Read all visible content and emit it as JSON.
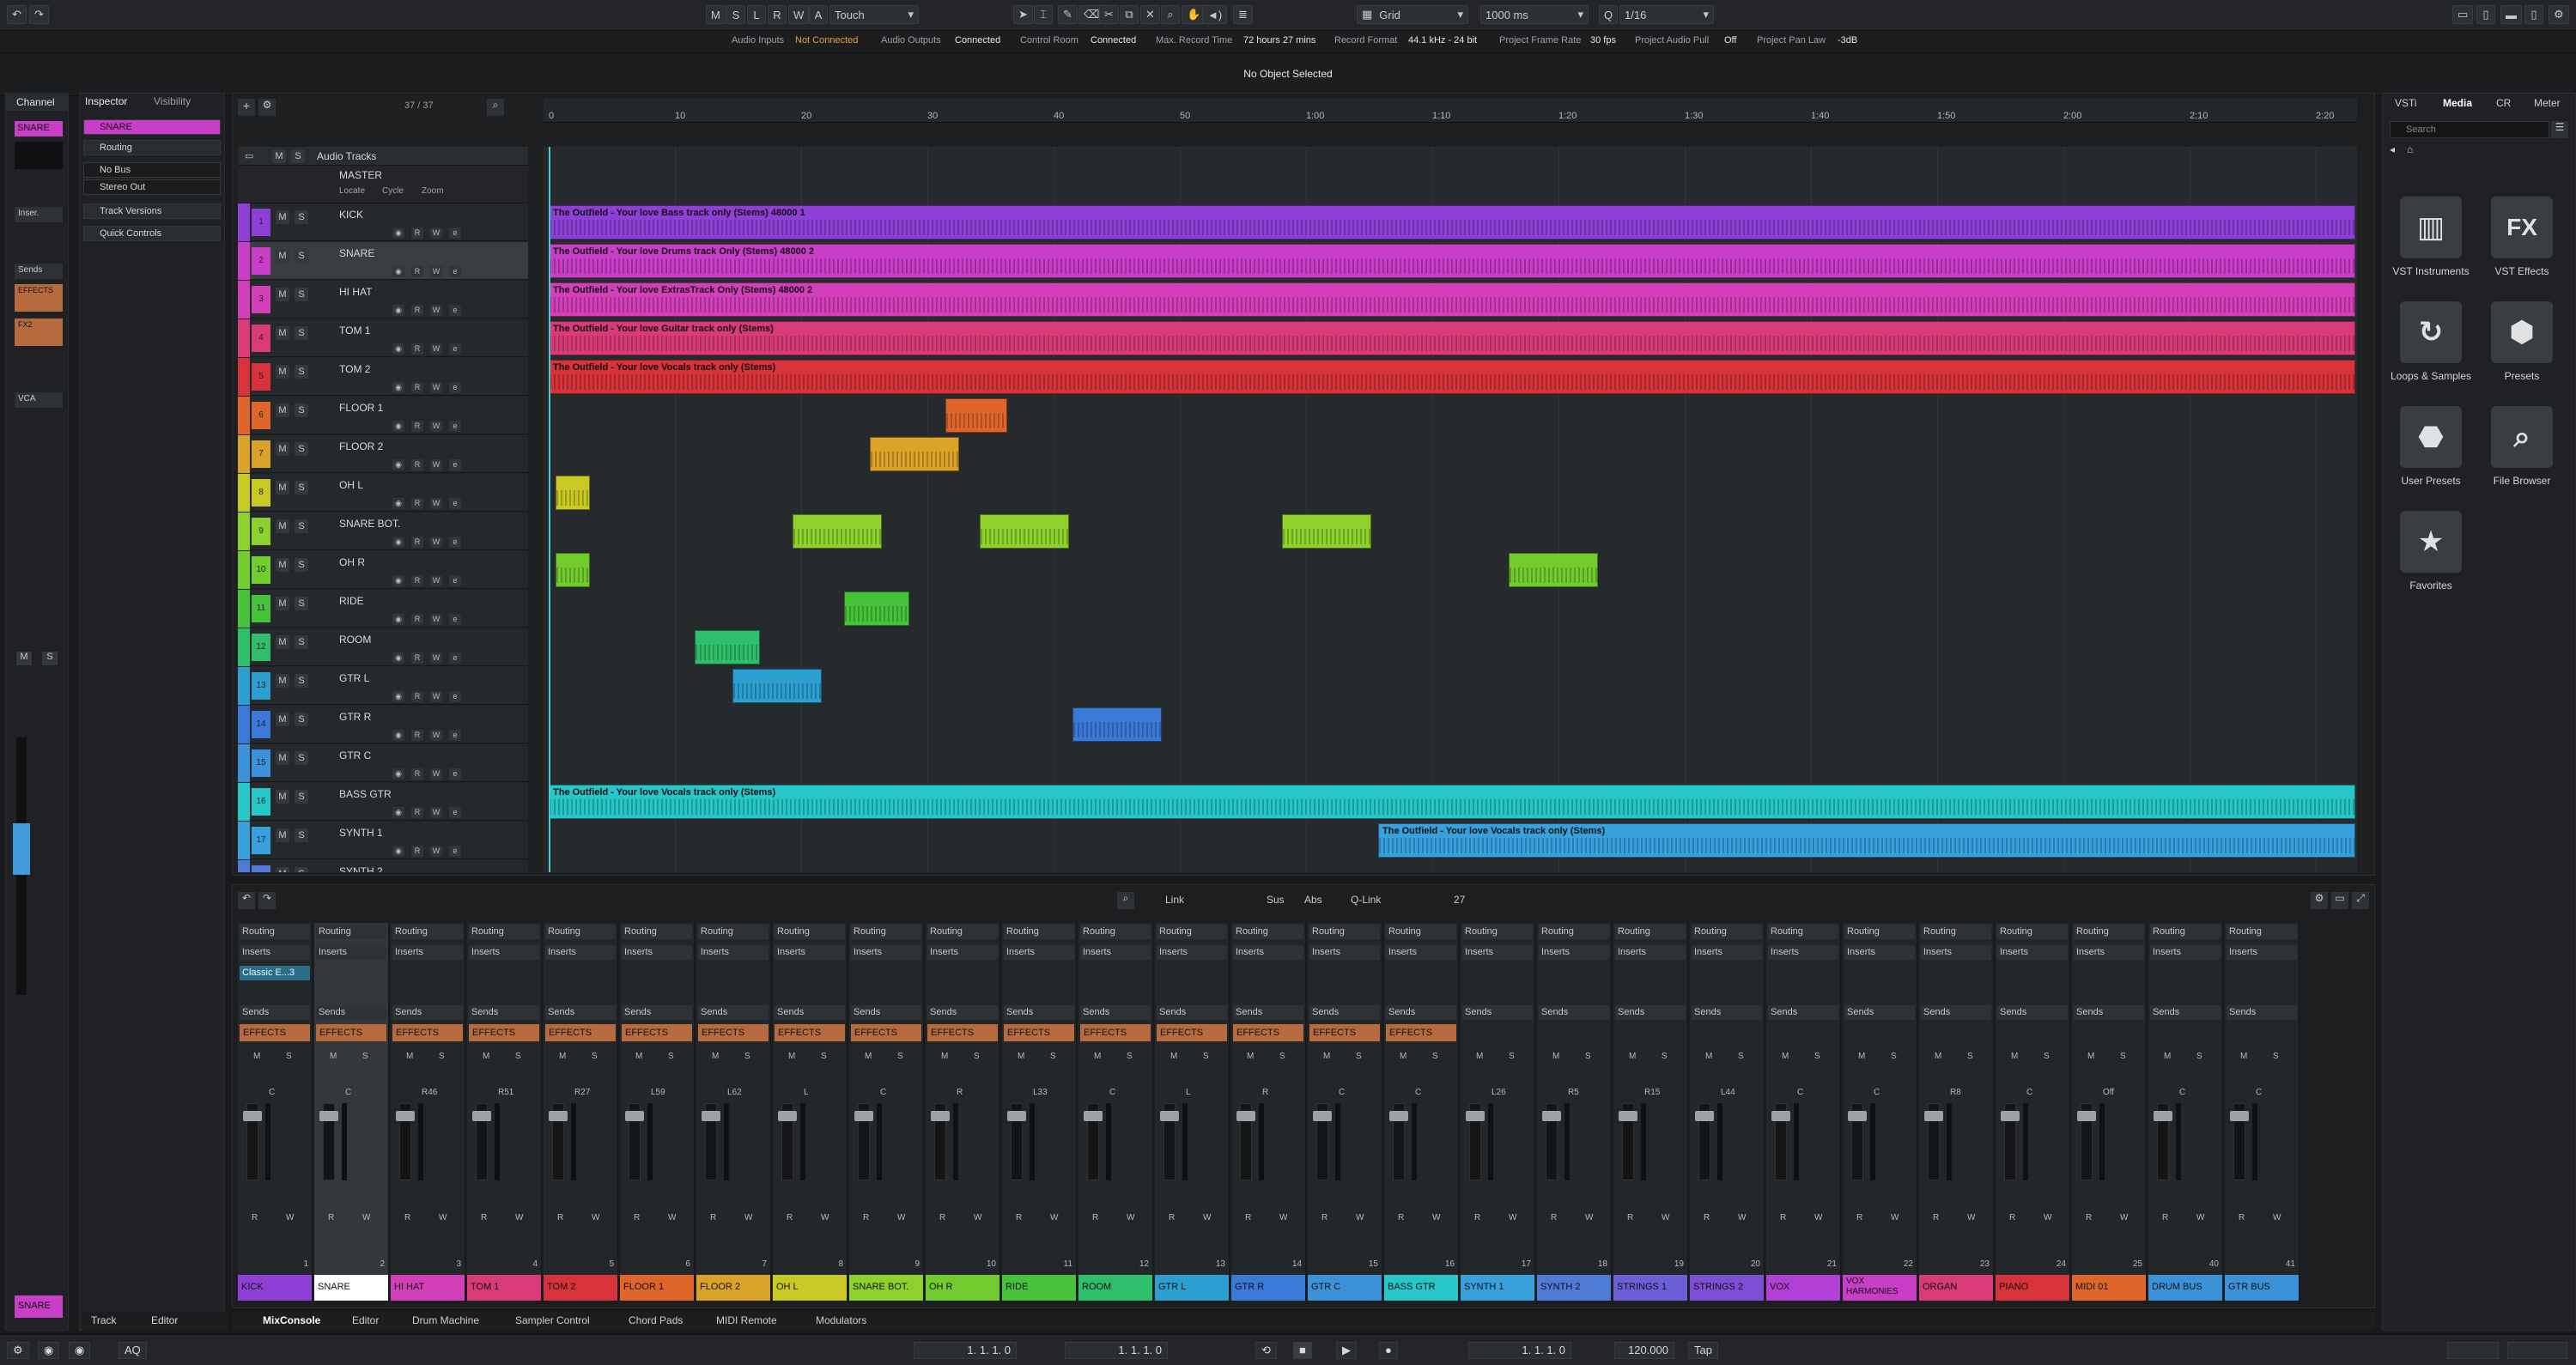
{
  "toolbar": {
    "msl": [
      "M",
      "S",
      "L",
      "R",
      "W",
      "A"
    ],
    "automation_mode": "Touch",
    "snap_type": "Grid",
    "grid_interval": "1000 ms",
    "quantize": "1/16"
  },
  "status": {
    "audio_inputs_label": "Audio Inputs",
    "audio_inputs_value": "Not Connected",
    "audio_outputs_label": "Audio Outputs",
    "audio_outputs_value": "Connected",
    "control_room_label": "Control Room",
    "control_room_value": "Connected",
    "max_record_label": "Max. Record Time",
    "max_record_value": "72 hours 27 mins",
    "record_format_label": "Record Format",
    "record_format_value": "44.1 kHz - 24 bit",
    "frame_rate_label": "Project Frame Rate",
    "frame_rate_value": "30 fps",
    "audio_pull_label": "Project Audio Pull",
    "audio_pull_value": "Off",
    "pan_law_label": "Project Pan Law",
    "pan_law_value": "-3dB"
  },
  "info_line": "No Object Selected",
  "channel_pane": {
    "tab": "Channel",
    "track_name": "SNARE",
    "insert_label": "Inser.",
    "sends_label": "Sends",
    "effects_label": "EFFECTS",
    "fx2_label": "FX2",
    "vca_label": "VCA",
    "footer_name": "SNARE"
  },
  "inspector": {
    "tab_inspector": "Inspector",
    "tab_visibility": "Visibility",
    "track_name": "SNARE",
    "routing": "Routing",
    "input_bus": "No Bus",
    "output_bus": "Stereo Out",
    "track_versions": "Track Versions",
    "quick_controls": "Quick Controls"
  },
  "project": {
    "track_counter": "37 / 37",
    "folder_name": "Audio Tracks",
    "master_name": "MASTER",
    "locate_label": "Locate",
    "cycle_label": "Cycle",
    "zoom_label": "Zoom",
    "ruler_ticks": [
      "0",
      "10",
      "20",
      "30",
      "40",
      "50",
      "1:00",
      "1:10",
      "1:20",
      "1:30",
      "1:40",
      "1:50",
      "2:00",
      "2:10",
      "2:20"
    ],
    "tracks": [
      {
        "n": "1",
        "name": "KICK",
        "color": "#8e3fd6"
      },
      {
        "n": "2",
        "name": "SNARE",
        "color": "#c93ec7"
      },
      {
        "n": "3",
        "name": "HI HAT",
        "color": "#d23fb8"
      },
      {
        "n": "4",
        "name": "TOM 1",
        "color": "#d93a78"
      },
      {
        "n": "5",
        "name": "TOM 2",
        "color": "#d8323b"
      },
      {
        "n": "6",
        "name": "FLOOR 1",
        "color": "#e0652b"
      },
      {
        "n": "7",
        "name": "FLOOR 2",
        "color": "#dba229"
      },
      {
        "n": "8",
        "name": "OH L",
        "color": "#c8c925"
      },
      {
        "n": "9",
        "name": "SNARE BOT.",
        "color": "#8ed02c"
      },
      {
        "n": "10",
        "name": "OH R",
        "color": "#73cc2e"
      },
      {
        "n": "11",
        "name": "RIDE",
        "color": "#46c33a"
      },
      {
        "n": "12",
        "name": "ROOM",
        "color": "#2fbf6b"
      },
      {
        "n": "13",
        "name": "GTR L",
        "color": "#2a9fd0"
      },
      {
        "n": "14",
        "name": "GTR R",
        "color": "#3a79d8"
      },
      {
        "n": "15",
        "name": "GTR C",
        "color": "#3b92d8"
      },
      {
        "n": "16",
        "name": "BASS GTR",
        "color": "#26c6c9"
      },
      {
        "n": "17",
        "name": "SYNTH 1",
        "color": "#38a0dd"
      },
      {
        "n": "18",
        "name": "SYNTH 2",
        "color": "#4f7ad6"
      }
    ],
    "clip_titles": {
      "kick": "The Outfield - Your love Bass track only (Stems) 48000 1",
      "snare": "The Outfield - Your love Drums track Only (Stems) 48000 2",
      "hihat": "The Outfield - Your love ExtrasTrack Only (Stems) 48000 2",
      "tom1": "The Outfield - Your love Guitar track only (Stems)",
      "tom2": "The Outfield - Your love Vocals track only (Stems)",
      "bass": "The Outfield - Your love Vocals track only (Stems)",
      "synth1": "The Outfield - Your love Vocals track only (Stems)"
    }
  },
  "mixer": {
    "link": "Link",
    "sus": "Sus",
    "abs": "Abs",
    "qlink": "Q-Link",
    "count": "27",
    "routing_label": "Routing",
    "inserts_label": "Inserts",
    "sends_label": "Sends",
    "effects_label": "EFFECTS",
    "insert_plugin": "Classic E...3",
    "strips": [
      {
        "name": "KICK",
        "color": "#8e3fd6",
        "num": "1",
        "pan": "C"
      },
      {
        "name": "SNARE",
        "color": "#ffffff",
        "num": "2",
        "pan": "C"
      },
      {
        "name": "HI HAT",
        "color": "#d23fb8",
        "num": "3",
        "pan": "R46"
      },
      {
        "name": "TOM 1",
        "color": "#d93a78",
        "num": "4",
        "pan": "R51"
      },
      {
        "name": "TOM 2",
        "color": "#d8323b",
        "num": "5",
        "pan": "R27"
      },
      {
        "name": "FLOOR 1",
        "color": "#e0652b",
        "num": "6",
        "pan": "L59"
      },
      {
        "name": "FLOOR 2",
        "color": "#dba229",
        "num": "7",
        "pan": "L62"
      },
      {
        "name": "OH L",
        "color": "#c8c925",
        "num": "8",
        "pan": "L"
      },
      {
        "name": "SNARE BOT.",
        "color": "#8ed02c",
        "num": "9",
        "pan": "C"
      },
      {
        "name": "OH R",
        "color": "#73cc2e",
        "num": "10",
        "pan": "R"
      },
      {
        "name": "RIDE",
        "color": "#46c33a",
        "num": "11",
        "pan": "L33"
      },
      {
        "name": "ROOM",
        "color": "#2fbf6b",
        "num": "12",
        "pan": "C"
      },
      {
        "name": "GTR L",
        "color": "#2a9fd0",
        "num": "13",
        "pan": "L"
      },
      {
        "name": "GTR R",
        "color": "#3a79d8",
        "num": "14",
        "pan": "R"
      },
      {
        "name": "GTR C",
        "color": "#3b92d8",
        "num": "15",
        "pan": "C"
      },
      {
        "name": "BASS GTR",
        "color": "#26c6c9",
        "num": "16",
        "pan": "C"
      },
      {
        "name": "SYNTH 1",
        "color": "#38a0dd",
        "num": "17",
        "pan": "L26"
      },
      {
        "name": "SYNTH 2",
        "color": "#4f7ad6",
        "num": "18",
        "pan": "R5"
      },
      {
        "name": "STRINGS 1",
        "color": "#6a5fd6",
        "num": "19",
        "pan": "R15"
      },
      {
        "name": "STRINGS 2",
        "color": "#7e4fd6",
        "num": "20",
        "pan": "L44"
      },
      {
        "name": "VOX",
        "color": "#b23fd6",
        "num": "21",
        "pan": "C"
      },
      {
        "name": "VOX HARMONIES",
        "color": "#c93ec7",
        "num": "22",
        "pan": "C"
      },
      {
        "name": "ORGAN",
        "color": "#d93a78",
        "num": "23",
        "pan": "R8"
      },
      {
        "name": "PIANO",
        "color": "#d8323b",
        "num": "24",
        "pan": "C"
      },
      {
        "name": "MIDI 01",
        "color": "#e0652b",
        "num": "25",
        "pan": "Off"
      },
      {
        "name": "DRUM BUS",
        "color": "#3b92d8",
        "num": "40",
        "pan": "C"
      },
      {
        "name": "GTR BUS",
        "color": "#3b92d8",
        "num": "41",
        "pan": "C"
      }
    ]
  },
  "lower_tabs": [
    "Track",
    "Editor"
  ],
  "zone_tabs": [
    "MixConsole",
    "Editor",
    "Drum Machine",
    "Sampler Control",
    "Chord Pads",
    "MIDI Remote",
    "Modulators"
  ],
  "right_zone": {
    "tabs": [
      "VSTi",
      "Media",
      "CR",
      "Meter"
    ],
    "search_placeholder": "Search",
    "tiles": [
      {
        "label": "VST Instruments",
        "icon": "piano-keys-icon"
      },
      {
        "label": "VST Effects",
        "icon": "fx-icon"
      },
      {
        "label": "Loops & Samples",
        "icon": "loop-icon"
      },
      {
        "label": "Presets",
        "icon": "hexagons-icon"
      },
      {
        "label": "User Presets",
        "icon": "user-hexagon-icon"
      },
      {
        "label": "File Browser",
        "icon": "folder-search-icon"
      },
      {
        "label": "Favorites",
        "icon": "star-icon"
      }
    ]
  },
  "transport": {
    "left_locator": "1. 1. 1.   0",
    "right_locator": "1. 1. 1.   0",
    "position": "1. 1. 1.   0",
    "tempo": "120.000",
    "tap": "Tap"
  }
}
